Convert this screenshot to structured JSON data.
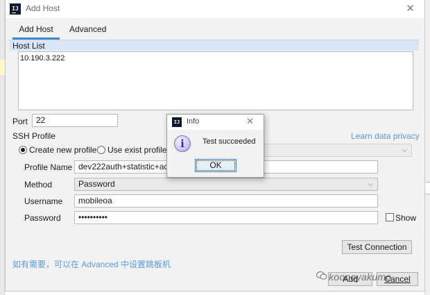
{
  "dialog": {
    "app_icon_text": "IJ",
    "title": "Add Host",
    "close": "✕"
  },
  "tabs": [
    {
      "label": "Add Host",
      "active": true
    },
    {
      "label": "Advanced",
      "active": false
    }
  ],
  "host_list": {
    "label": "Host List",
    "value": "10.190.3.222"
  },
  "port": {
    "label": "Port",
    "value": "22"
  },
  "ssh_profile": {
    "label": "SSH Profile",
    "learn_link": "Learn data privacy",
    "create_new_label": "Create new profile",
    "use_exist_label": "Use exist profile",
    "selected": "create_new"
  },
  "profile_name": {
    "label": "Profile Name",
    "value": "dev222auth+statistic+addr"
  },
  "method": {
    "label": "Method",
    "value": "Password"
  },
  "username": {
    "label": "Username",
    "value": "mobileoa"
  },
  "password": {
    "label": "Password",
    "value": "••••••••••",
    "show_label": "Show",
    "show_checked": false
  },
  "buttons": {
    "test_connection": "Test Connection",
    "add": "Add",
    "cancel": "Cancel"
  },
  "hint": "如有需要，可以在 Advanced 中设置跳板机",
  "watermark": "koonoyakumo",
  "info_dialog": {
    "app_icon_text": "IJ",
    "title": "Info",
    "close": "✕",
    "icon_glyph": "i",
    "message": "Test succeeded",
    "ok_label": "OK"
  },
  "colors": {
    "accent": "#4083c9",
    "link": "#5b9bd5",
    "header_bg": "#d9e6f5"
  },
  "icons": {
    "info": "info-icon",
    "chevron": "chevron-down-icon",
    "watermark": "wechat-icon"
  }
}
